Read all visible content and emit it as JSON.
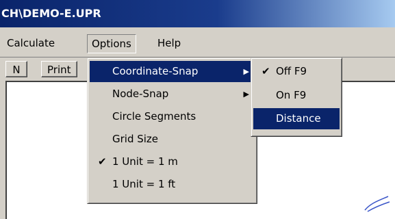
{
  "window": {
    "title": "CH\\DEMO-E.UPR"
  },
  "menubar": {
    "items": [
      {
        "label": "Calculate"
      },
      {
        "label": "Options"
      },
      {
        "label": "Help"
      }
    ]
  },
  "toolbar": {
    "n_label": "N",
    "print_label": "Print"
  },
  "options_menu": {
    "items": [
      {
        "label": "Coordinate-Snap",
        "has_submenu": true,
        "selected": true
      },
      {
        "label": "Node-Snap",
        "has_submenu": true
      },
      {
        "label": "Circle Segments"
      },
      {
        "label": "Grid Size"
      },
      {
        "label": "1 Unit = 1 m",
        "checked": true
      },
      {
        "label": "1 Unit = 1 ft"
      }
    ]
  },
  "coordinate_snap_submenu": {
    "items": [
      {
        "label": "Off F9",
        "checked": true
      },
      {
        "label": "On F9"
      },
      {
        "label": "Distance",
        "selected": true
      }
    ]
  },
  "colors": {
    "highlight": "#0a246a",
    "face": "#d4d0c8"
  }
}
